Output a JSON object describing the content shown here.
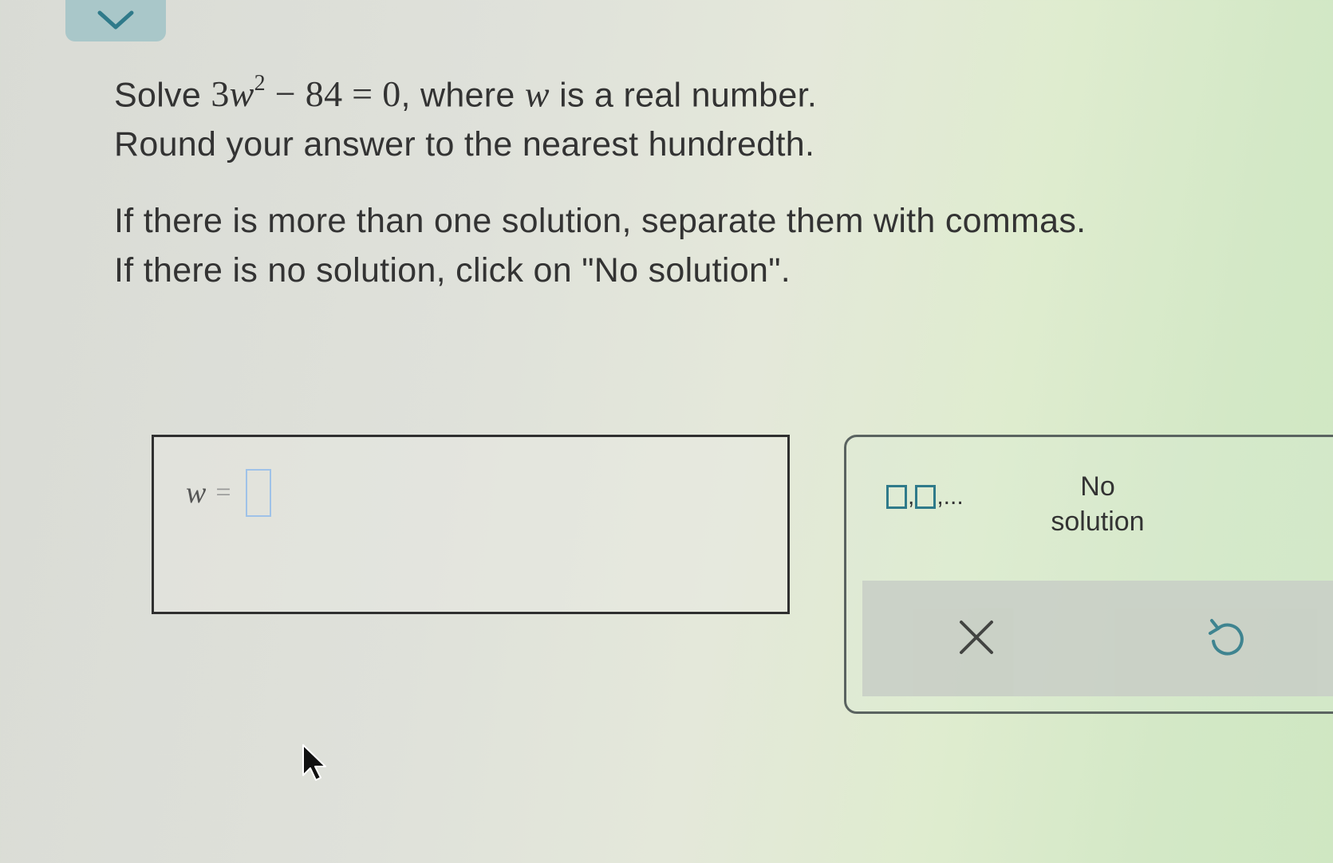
{
  "question": {
    "line1_prefix": "Solve ",
    "equation_coef": "3",
    "equation_var": "w",
    "equation_exp": "2",
    "equation_rest": " − 84 = 0",
    "line1_suffix": ", where ",
    "line1_var": "w",
    "line1_end": " is a real number.",
    "line2": "Round your answer to the nearest hundredth.",
    "line3": "If there is more than one solution, separate them with commas.",
    "line4": "If there is no solution, click on \"No solution\"."
  },
  "answer": {
    "variable": "w",
    "equals": "=",
    "value": ""
  },
  "keypad": {
    "multi_comma": ",",
    "multi_ellipsis": ",...",
    "no_solution_line1": "No",
    "no_solution_line2": "solution"
  },
  "icons": {
    "collapse": "chevron-down-icon",
    "clear": "close-icon",
    "undo": "undo-icon",
    "cursor": "mouse-pointer-icon"
  },
  "colors": {
    "accent": "#2f7a8a",
    "tab": "#a9c7c9",
    "input_border": "#9fc2e8"
  }
}
